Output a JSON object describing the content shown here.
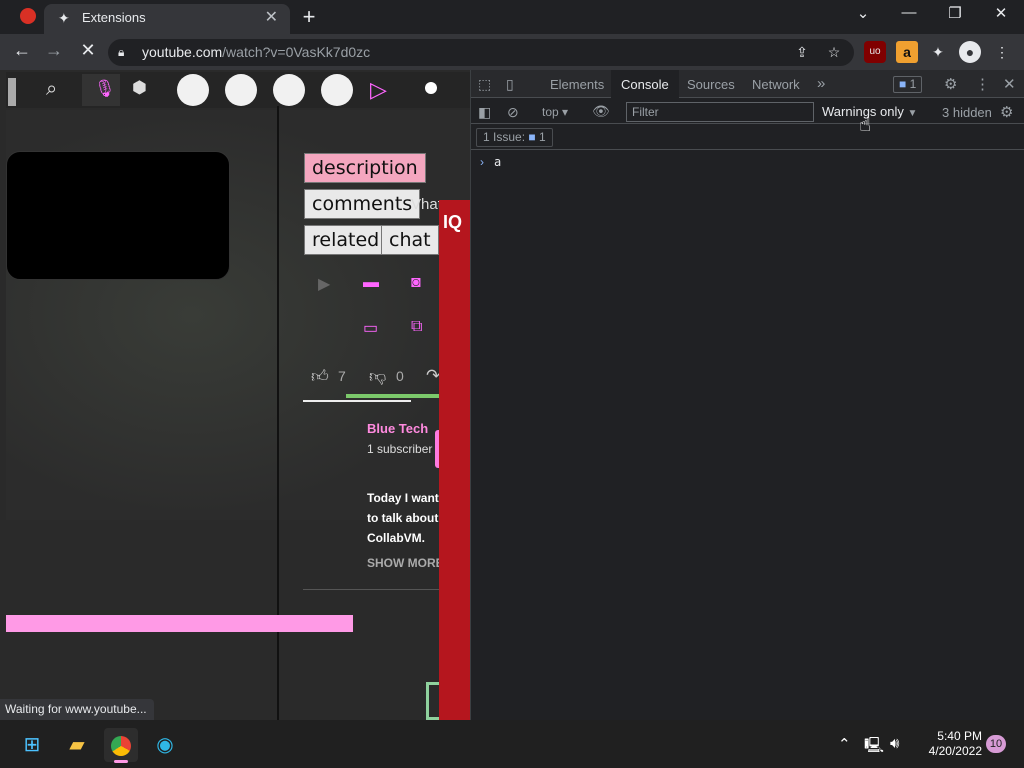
{
  "browser": {
    "tab_title": "Extensions",
    "tab_close": "✕",
    "new_tab": "+",
    "url_host": "youtube.com",
    "url_path": "/watch?v=0VasKk7d0zc",
    "status_text": "Waiting for www.youtube...",
    "window_controls": {
      "dropdown": "⌄",
      "minimize": "—",
      "restore": "❐",
      "close": "✕"
    },
    "extension_amazon": "a"
  },
  "page": {
    "tabs": [
      "description",
      "comments",
      "related",
      "chat"
    ],
    "overflow_text": "Vhat",
    "side_label": "IQ",
    "likes": "7",
    "dislikes": "0",
    "channel_name": "Blue Tech",
    "subscribers": "1 subscriber",
    "description": "Today I want to talk about CollabVM.",
    "show_more": "SHOW MORE"
  },
  "devtools": {
    "tabs": [
      "Elements",
      "Console",
      "Sources",
      "Network"
    ],
    "active_tab": "Console",
    "issues_badge": "1",
    "context": "top",
    "filter_placeholder": "Filter",
    "levels": "Warnings only",
    "hidden_count": "3 hidden",
    "issues_label": "1 Issue:",
    "issues_count": "1",
    "console_input": "a"
  },
  "taskbar": {
    "time": "5:40 PM",
    "date": "4/20/2022",
    "notifications": "10"
  },
  "colors": {
    "accent_pink": "#ff66ff",
    "devtools_bg": "#202124",
    "iq_red": "#b5161e"
  }
}
